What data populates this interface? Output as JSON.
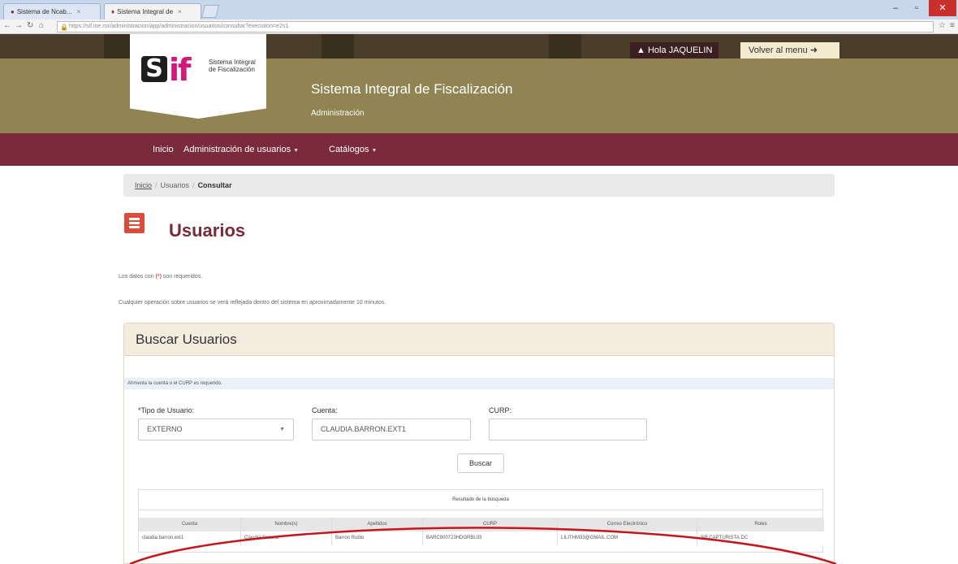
{
  "browser": {
    "tabs": [
      {
        "label": "Sistema de Ncab..."
      },
      {
        "label": "Sistema Integral de"
      }
    ],
    "url": "https://sif.ine.mx/administracion/app/administracion/usuarios/consultar?execution=e2s1",
    "window_controls": {
      "minimize": "–",
      "maximize": "▫",
      "close": "✕"
    }
  },
  "header": {
    "logo": {
      "s": "S",
      "if": "if",
      "text": "Sistema Integral de Fiscalización"
    },
    "user_greeting": "Hola JAQUELIN",
    "menu_link": "Volver al menu",
    "site_title": "Sistema Integral de Fiscalización",
    "site_subtitle": "Administración"
  },
  "nav": {
    "items": [
      {
        "label": "Inicio"
      },
      {
        "label": "Administración de usuarios"
      },
      {
        "label": "Catálogos"
      }
    ]
  },
  "breadcrumb": {
    "home": "Inicio",
    "section": "Usuarios",
    "current": "Consultar"
  },
  "page": {
    "title": "Usuarios",
    "note_required_pre": "Los datos con",
    "note_required_mark": "(*)",
    "note_required_post": "son requeridos.",
    "note_operation": "Cualquier operación sobre usuarios se verá reflejada dentro del sistema en aproximadamente 10 minutos."
  },
  "search": {
    "panel_title": "Buscar Usuarios",
    "info": "Ahmenta la cuenta o el CURP es requerido.",
    "tipo_label": "*Tipo de Usuario:",
    "tipo_value": "EXTERNO",
    "cuenta_label": "Cuenta:",
    "cuenta_value": "CLAUDIA.BARRON.EXT1",
    "curp_label": "CURP:",
    "curp_value": "",
    "button": "Buscar"
  },
  "results": {
    "caption": "Resultado de la búsqueda",
    "columns": [
      "Cuenta",
      "Nombre(s)",
      "Apellidos",
      "CURP",
      "Correo Electrónico",
      "Roles"
    ],
    "rows": [
      [
        "claudia.barron.ext1",
        "Claudia Susana",
        "Barron Rubio",
        "BARC900723HDGRBL03",
        "LILITHM33@GMAIL.COM",
        "SIF.CAPTURISTA.DC"
      ]
    ]
  },
  "colors": {
    "header_bg": "#908453",
    "nav_bg": "#7a2a3a",
    "title_color": "#7a2a3a",
    "annotation": "#c4161c"
  }
}
